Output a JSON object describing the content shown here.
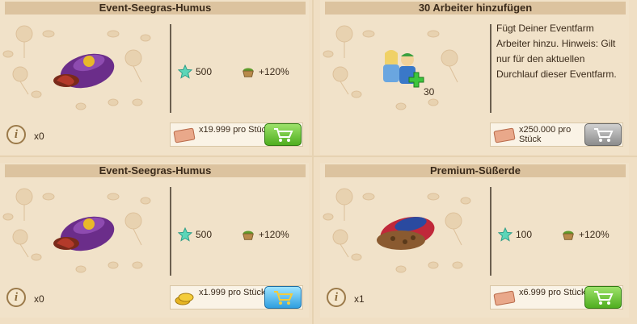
{
  "cards": [
    {
      "title": "Event-Seegras-Humus",
      "xp": "500",
      "bonus": "+120%",
      "owned": "x0",
      "price": "x19.999 pro Stück",
      "currency_icon": "ticket-icon",
      "buy_state": "green"
    },
    {
      "title": "30 Arbeiter hinzufügen",
      "description": "Fügt Deiner Eventfarm Arbeiter hinzu. Hinweis: Gilt nur für den aktuellen Durchlauf dieser Eventfarm.",
      "worker_count": "30",
      "price": "x250.000 pro Stück",
      "currency_icon": "ticket-icon",
      "buy_state": "gray"
    },
    {
      "title": "Event-Seegras-Humus",
      "xp": "500",
      "bonus": "+120%",
      "owned": "x0",
      "price": "x1.999 pro Stück",
      "currency_icon": "coins-icon",
      "buy_state": "blue"
    },
    {
      "title": "Premium-Süßerde",
      "xp": "100",
      "bonus": "+120%",
      "owned": "x1",
      "price": "x6.999 pro Stück",
      "currency_icon": "ticket-icon",
      "buy_state": "green"
    }
  ],
  "colors": {
    "panel_bg": "#f1e2c9",
    "title_bar": "#dcc39f",
    "buy_green": "#4fae1f",
    "buy_gray": "#8c8c8c",
    "buy_blue": "#2f9fe0"
  }
}
